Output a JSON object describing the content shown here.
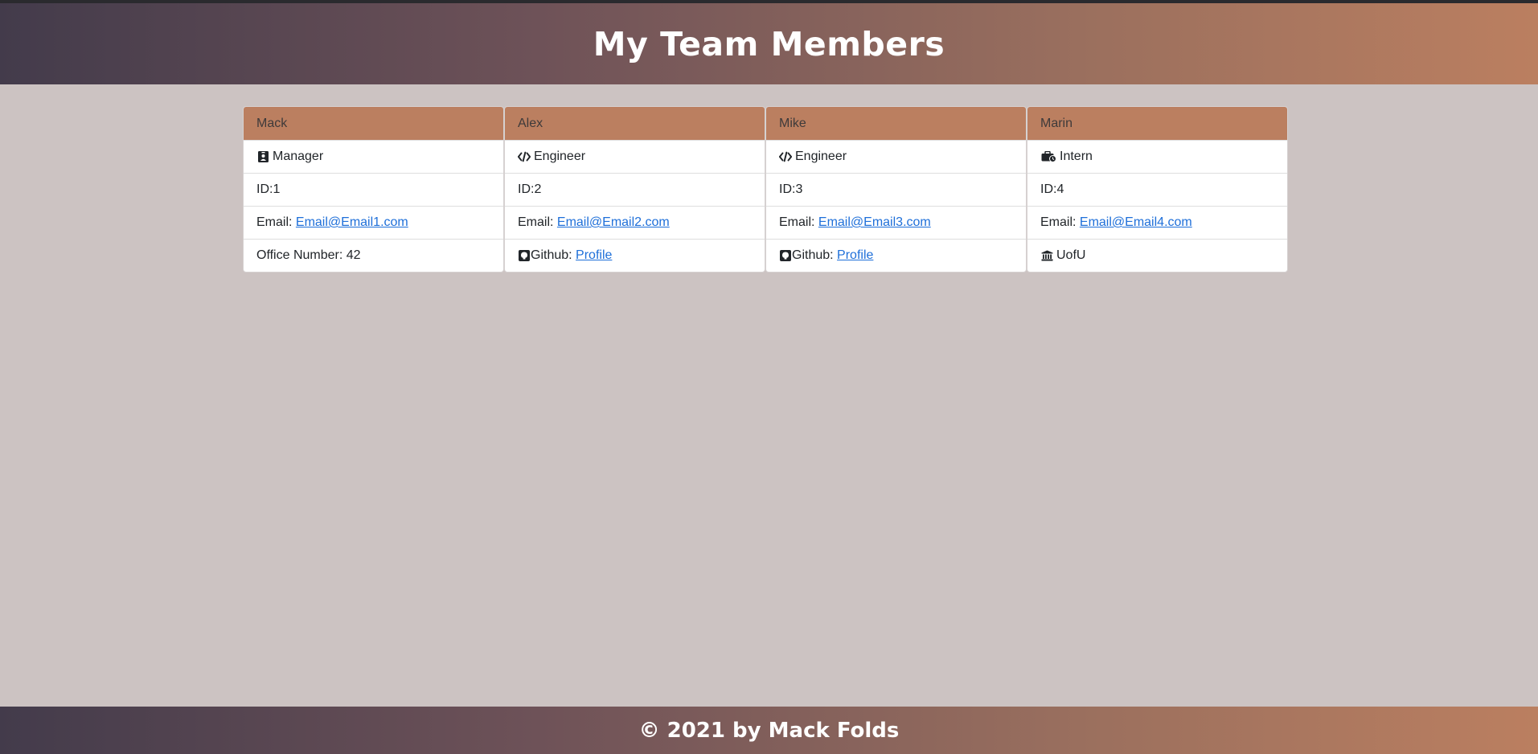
{
  "header": {
    "title": "My Team Members"
  },
  "team": [
    {
      "name": "Mack",
      "role": "Manager",
      "role_icon": "id-badge-icon",
      "id_text": "ID:1",
      "email_label": "Email:",
      "email": "Email@Email1.com",
      "extra_label": "Office Number: 42"
    },
    {
      "name": "Alex",
      "role": "Engineer",
      "role_icon": "code-icon",
      "id_text": "ID:2",
      "email_label": "Email:",
      "email": "Email@Email2.com",
      "extra_label": "Github:",
      "extra_link": "Profile",
      "extra_icon": "github-icon"
    },
    {
      "name": "Mike",
      "role": "Engineer",
      "role_icon": "code-icon",
      "id_text": "ID:3",
      "email_label": "Email:",
      "email": "Email@Email3.com",
      "extra_label": "Github:",
      "extra_link": "Profile",
      "extra_icon": "github-icon"
    },
    {
      "name": "Marin",
      "role": "Intern",
      "role_icon": "briefcase-clock-icon",
      "id_text": "ID:4",
      "email_label": "Email:",
      "email": "Email@Email4.com",
      "extra_label": "UofU",
      "extra_icon": "university-icon"
    }
  ],
  "footer": {
    "text": "© 2021 by Mack Folds"
  },
  "colors": {
    "card_header": "#bb7f60",
    "gradient_start": "#433b4b",
    "gradient_end": "#bb7f60",
    "background": "#ccc3c2",
    "link": "#1e6fd9"
  }
}
